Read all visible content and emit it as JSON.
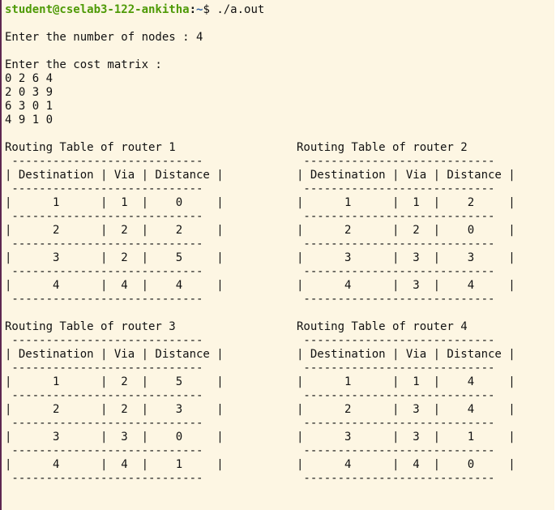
{
  "prompt": {
    "user_host": "student@cselab3-122-ankitha",
    "separator": ":",
    "path": "~",
    "symbol": "$ ",
    "command": "./a.out"
  },
  "output": {
    "nodes_prompt": "Enter the number of nodes : 4",
    "cost_prompt": "Enter the cost matrix :",
    "matrix_rows": [
      "0 2 6 4",
      "2 0 3 9",
      "6 3 0 1",
      "4 9 1 0"
    ]
  },
  "tables": [
    {
      "title": "Routing Table of router 1",
      "border": " ----------------------------",
      "header": "| Destination | Via | Distance |",
      "rows": [
        "|      1      |  1  |    0     |",
        "|      2      |  2  |    2     |",
        "|      3      |  2  |    5     |",
        "|      4      |  4  |    4     |"
      ]
    },
    {
      "title": "Routing Table of router 2",
      "border": " ----------------------------",
      "header": "| Destination | Via | Distance |",
      "rows": [
        "|      1      |  1  |    2     |",
        "|      2      |  2  |    0     |",
        "|      3      |  3  |    3     |",
        "|      4      |  3  |    4     |"
      ]
    },
    {
      "title": "Routing Table of router 3",
      "border": " ----------------------------",
      "header": "| Destination | Via | Distance |",
      "rows": [
        "|      1      |  2  |    5     |",
        "|      2      |  2  |    3     |",
        "|      3      |  3  |    0     |",
        "|      4      |  4  |    1     |"
      ]
    },
    {
      "title": "Routing Table of router 4",
      "border": " ----------------------------",
      "header": "| Destination | Via | Distance |",
      "rows": [
        "|      1      |  1  |    4     |",
        "|      2      |  3  |    4     |",
        "|      3      |  3  |    1     |",
        "|      4      |  4  |    0     |"
      ]
    }
  ]
}
